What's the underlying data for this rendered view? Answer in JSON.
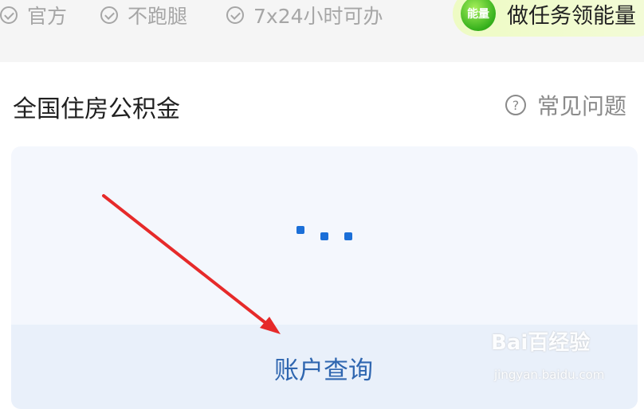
{
  "features": [
    {
      "label": "官方"
    },
    {
      "label": "不跑腿"
    },
    {
      "label": "7x24小时可办"
    }
  ],
  "energy": {
    "badge": "能量",
    "label": "做任务领能量"
  },
  "section": {
    "title": "全国住房公积金",
    "faq": "常见问题"
  },
  "card": {
    "action_label": "账户查询"
  },
  "watermark": {
    "brand": "Bai百经验",
    "url": "jingyan.baidu.com"
  },
  "colors": {
    "accent": "#1b6fd8",
    "arrow": "#e62a2a"
  }
}
